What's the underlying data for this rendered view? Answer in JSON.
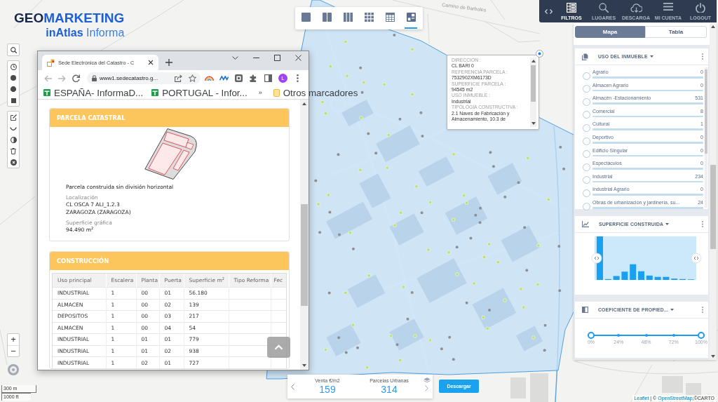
{
  "logo": {
    "title_parts": [
      "GEO",
      "MARKETING"
    ],
    "subtitle": "**inAtlas** Informa"
  },
  "map": {
    "street_labels": [
      "Camino de Barboles"
    ]
  },
  "tool_groups": [
    {
      "tools": [
        {
          "kind": "search"
        }
      ]
    },
    {
      "tools": [
        {
          "kind": "clock"
        },
        {
          "kind": "dot"
        },
        {
          "kind": "octagon"
        },
        {
          "kind": "square"
        }
      ]
    },
    {
      "tools": [
        {
          "kind": "edit"
        },
        {
          "kind": "curve"
        },
        {
          "kind": "contrast"
        },
        {
          "kind": "trash"
        },
        {
          "kind": "clear"
        }
      ]
    }
  ],
  "layout_switcher": [
    {
      "kind": "single",
      "selected": false
    },
    {
      "kind": "two_columns",
      "selected": false
    },
    {
      "kind": "three_columns",
      "selected": false
    },
    {
      "kind": "grid",
      "selected": false
    },
    {
      "kind": "table",
      "selected": false
    },
    {
      "kind": "split",
      "selected": true
    }
  ],
  "nav_bar": [
    {
      "kind": "filters",
      "label": "FILTROS",
      "selected": true
    },
    {
      "kind": "places",
      "label": "LUGARES",
      "selected": false
    },
    {
      "kind": "download",
      "label": "DESCARGA",
      "selected": false
    },
    {
      "kind": "account",
      "label": "MI CUENTA",
      "selected": false
    },
    {
      "kind": "logout",
      "label": "LOGOUT",
      "selected": false
    }
  ],
  "browser": {
    "tab_title": "Sede Electrónica del Catastro - C",
    "nav_buttons": [
      {
        "kind": "back",
        "disabled": true
      },
      {
        "kind": "forward",
        "disabled": true
      },
      {
        "kind": "reload",
        "disabled": false
      }
    ],
    "url": "www1.sedecatastro.g...",
    "profile_initial": "L",
    "bookmarks": [
      "ESPAÑA- InformaD...",
      "PORTUGAL - Infor..."
    ],
    "bookmarks_overflow": "»",
    "other_bookmarks": "Otros marcadores",
    "parcel": {
      "header": "PARCELA CATASTRAL",
      "type": "Parcela construida sin división horizontal",
      "fields": [
        {
          "label": "Localización",
          "lines": [
            "CL OSCA 7 ALI_1.2.3",
            "ZARAGOZA (ZARAGOZA)"
          ]
        },
        {
          "label": "Superficie gráfica",
          "lines": [
            "94.490 m$^{2}$"
          ]
        }
      ]
    },
    "construction": {
      "header": "CONSTRUCCIÓN",
      "columns": [
        "Uso principal",
        "Escalera",
        "Planta",
        "Puerta",
        "Superficie m$^{2}$",
        "Tipo Reforma",
        "Fec"
      ],
      "rows": [
        [
          "INDUSTRIAL",
          "1",
          "00",
          "01",
          "56.180"
        ],
        [
          "ALMACEN",
          "1",
          "00",
          "02",
          "139"
        ],
        [
          "DEPOSITOS",
          "1",
          "00",
          "03",
          "217"
        ],
        [
          "ALMACEN",
          "1",
          "00",
          "04",
          "54"
        ],
        [
          "INDUSTRIAL",
          "1",
          "01",
          "01",
          "779"
        ],
        [
          "INDUSTRIAL",
          "1",
          "01",
          "02",
          "938"
        ],
        [
          "INDUSTRIAL",
          "1",
          "02",
          "01",
          "727"
        ]
      ]
    }
  },
  "popup": {
    "fields": [
      {
        "label": "DIRECCION :",
        "value": "CL BARI 0"
      },
      {
        "label": "REFERENCIA PARCELA :",
        "value": "7532902XM6173D"
      },
      {
        "label": "SUPERFICIE PARCELA :",
        "value": "94545 m2"
      },
      {
        "label": "USO INMUEBLE :",
        "value": "Industrial"
      },
      {
        "label": "TIPOLOGIA CONSTRUCTIVA :",
        "value": "2.1 Naves de Fabricación y Almacenamiento, 10.3 de"
      }
    ]
  },
  "side_panel": {
    "tabs": [
      {
        "label": "Mapa",
        "selected": true
      },
      {
        "label": "Tabla",
        "selected": false
      }
    ],
    "widgets": [
      {
        "kind": "categories",
        "title": "USO DEL INMUEBLE",
        "items": [
          {
            "name": "Agrario",
            "count": "0",
            "selected": false
          },
          {
            "name": "Almacen Agrario",
            "count": "0",
            "selected": false
          },
          {
            "name": "Almacén -Estacionamiento",
            "count": "531",
            "selected": false
          },
          {
            "name": "Comercial",
            "count": "8",
            "selected": false
          },
          {
            "name": "Cultural",
            "count": "1",
            "selected": false
          },
          {
            "name": "Deportivo",
            "count": "0",
            "selected": false
          },
          {
            "name": "Edificio Singular",
            "count": "0",
            "selected": false
          },
          {
            "name": "Espectáculos",
            "count": "0",
            "selected": false
          },
          {
            "name": "Industrial",
            "count": "234",
            "selected": false
          },
          {
            "name": "Industrial Agrario",
            "count": "0",
            "selected": false
          },
          {
            "name": "Obras de urbanización y jardinería, su...",
            "count": "24",
            "selected": false
          }
        ]
      },
      {
        "kind": "histogram",
        "title": "SUPERFICIE CONSTRUIDA"
      },
      {
        "kind": "range",
        "title": "COEFICIENTE DE PROPIED...",
        "handles": [
          {
            "level": 0
          },
          {
            "level": 1
          }
        ],
        "ticks": [
          "0%",
          "24%",
          "48%",
          "72%",
          "100%"
        ]
      }
    ]
  },
  "zoom_controls": [
    "+",
    "−"
  ],
  "scale": [
    "300 m",
    "1000 ft"
  ],
  "stats": [
    {
      "label": "Venta €/m2",
      "value": "159"
    },
    {
      "label": "Parcelas Urbanas",
      "value": "314"
    }
  ],
  "download_button": "Descargar",
  "attribution": [
    {
      "kind": "link",
      "text": "Leaflet"
    },
    {
      "kind": "text",
      "text": " | © "
    },
    {
      "kind": "link",
      "text": "OpenStreetMap"
    },
    {
      "kind": "text",
      "text": ",©CARTO"
    }
  ]
}
